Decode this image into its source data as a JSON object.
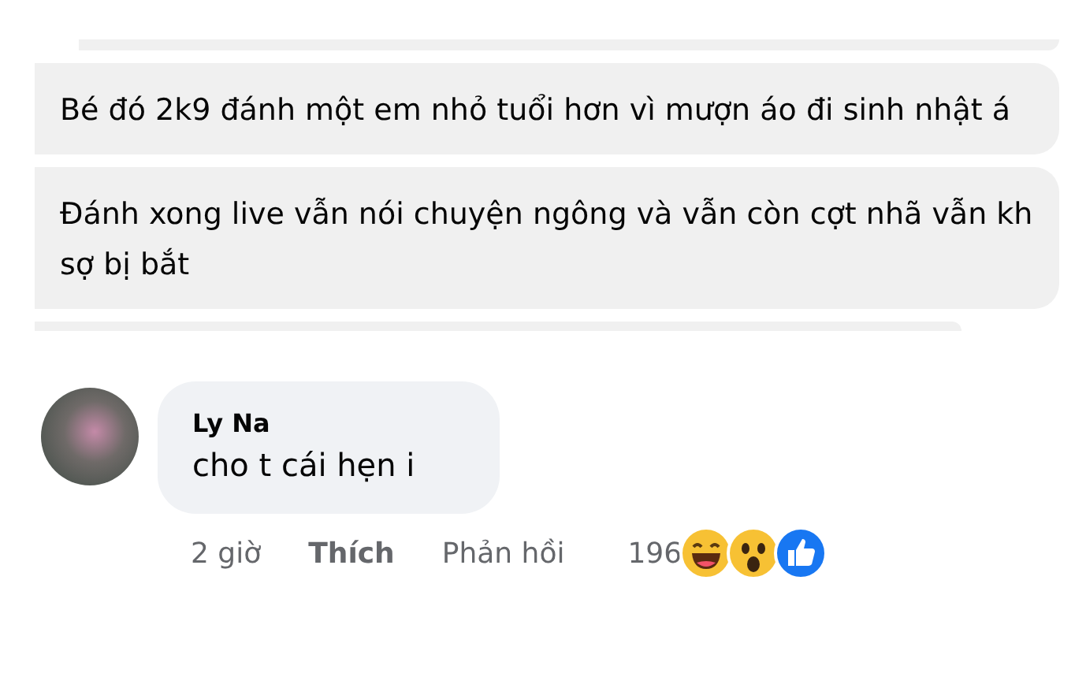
{
  "snippets": [
    {
      "text": "Bé đó 2k9 đánh một em nhỏ tuổi hơn vì mượn áo đi sinh nhật á"
    },
    {
      "text": "Đánh xong live vẫn nói chuyện ngông và vẫn còn cợt nhã vẫn kh sợ bị bắt"
    }
  ],
  "comment": {
    "author": "Ly Na",
    "text": "cho t cái hẹn i",
    "time": "2 giờ",
    "actions": [
      {
        "label": "Thích",
        "kind": "like"
      },
      {
        "label": "Phản hồi",
        "kind": "reply"
      }
    ],
    "reaction_count": "196"
  }
}
